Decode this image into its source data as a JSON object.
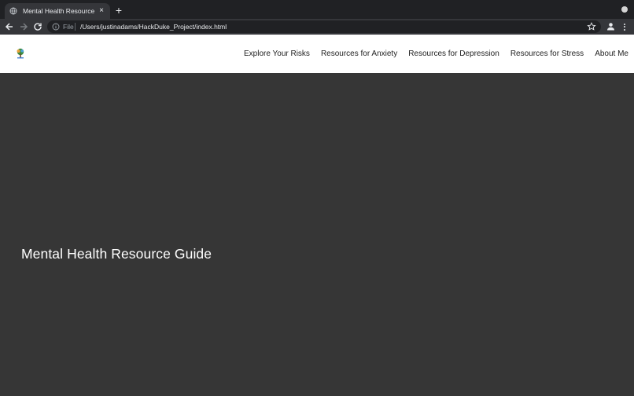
{
  "browser": {
    "tab": {
      "title": "Mental Health Resource Guide",
      "close_glyph": "×",
      "favicon": "globe-icon"
    },
    "new_tab_glyph": "+",
    "omnibox": {
      "scheme": "File",
      "url": "/Users/justinadams/HackDuke_Project/index.html"
    }
  },
  "site": {
    "logo": "tree-logo",
    "nav": [
      {
        "label": "Explore Your Risks"
      },
      {
        "label": "Resources for Anxiety"
      },
      {
        "label": "Resources for Depression"
      },
      {
        "label": "Resources for Stress"
      },
      {
        "label": "About Me"
      }
    ],
    "hero": {
      "title": "Mental Health Resource Guide"
    }
  },
  "colors": {
    "tabbar": "#202124",
    "toolbar": "#35363a",
    "header": "#ffffff",
    "hero": "#363636"
  }
}
